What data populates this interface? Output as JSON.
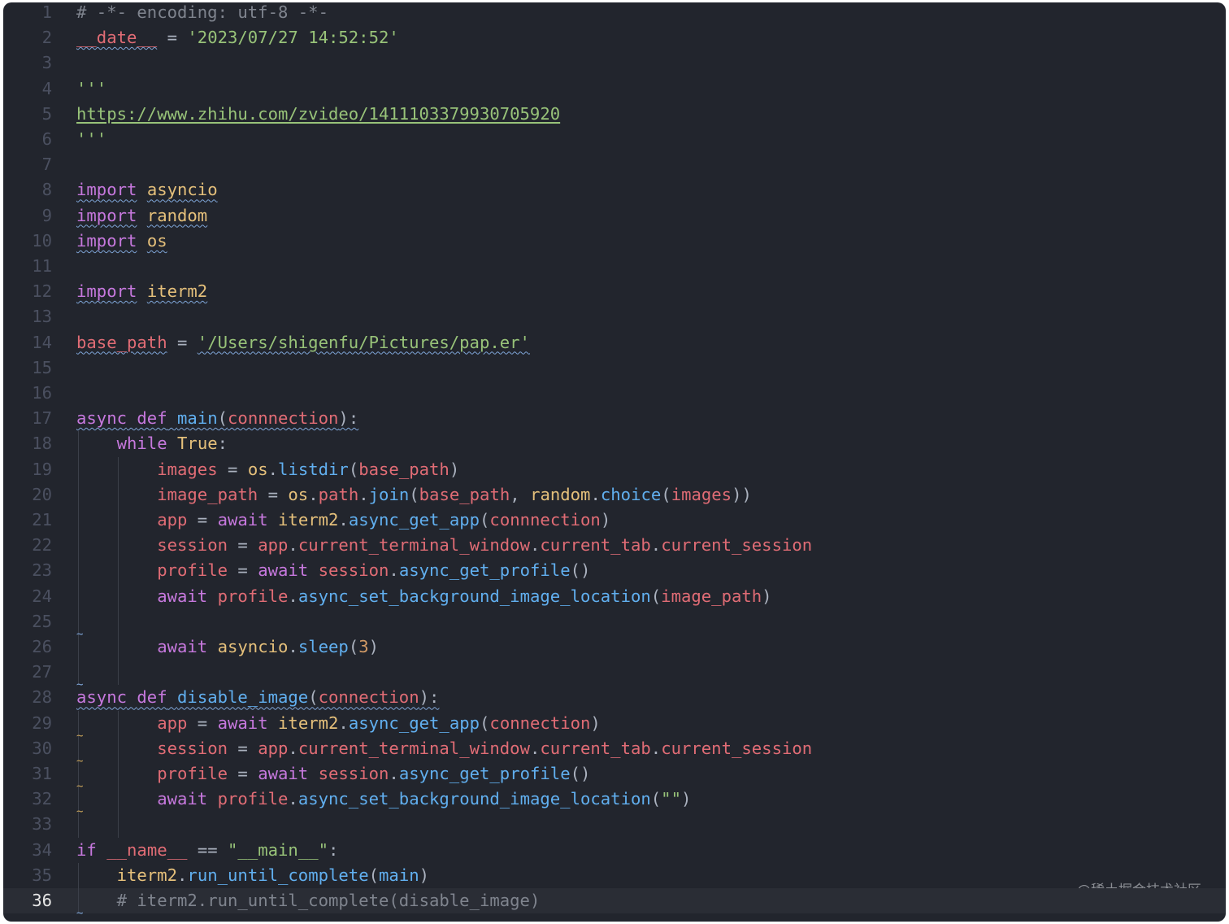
{
  "colors": {
    "background": "#22252d",
    "comment": "#7f848e",
    "keyword": "#c678dd",
    "variable": "#e06c75",
    "string": "#98c379",
    "function": "#61afef",
    "module": "#e5c07b",
    "plain": "#abb2bf",
    "number": "#d19a66",
    "url": "#98c379"
  },
  "lines": [
    {
      "n": "1",
      "tokens": [
        [
          "comment",
          "# -*- encoding: utf-8 -*-"
        ]
      ]
    },
    {
      "n": "2",
      "tokens": [
        [
          "variable",
          "__date__"
        ],
        [
          "plain",
          " = "
        ],
        [
          "string",
          "'2023/07/27 14:52:52'"
        ]
      ]
    },
    {
      "n": "3",
      "tokens": []
    },
    {
      "n": "4",
      "tokens": [
        [
          "string",
          "'''"
        ]
      ]
    },
    {
      "n": "5",
      "tokens": [
        [
          "url",
          "https://www.zhihu.com/zvideo/1411103379930705920"
        ]
      ]
    },
    {
      "n": "6",
      "tokens": [
        [
          "string",
          "'''"
        ]
      ]
    },
    {
      "n": "7",
      "tokens": []
    },
    {
      "n": "8",
      "tokens": [
        [
          "keyword",
          "import"
        ],
        [
          "plain",
          " "
        ],
        [
          "module",
          "asyncio"
        ]
      ]
    },
    {
      "n": "9",
      "tokens": [
        [
          "keyword",
          "import"
        ],
        [
          "plain",
          " "
        ],
        [
          "module",
          "random"
        ]
      ]
    },
    {
      "n": "10",
      "tokens": [
        [
          "keyword",
          "import"
        ],
        [
          "plain",
          " "
        ],
        [
          "module",
          "os"
        ]
      ]
    },
    {
      "n": "11",
      "tokens": []
    },
    {
      "n": "12",
      "tokens": [
        [
          "keyword",
          "import"
        ],
        [
          "plain",
          " "
        ],
        [
          "module",
          "iterm2"
        ]
      ]
    },
    {
      "n": "13",
      "tokens": []
    },
    {
      "n": "14",
      "tokens": [
        [
          "variable",
          "base_path"
        ],
        [
          "plain",
          " = "
        ],
        [
          "string",
          "'/Users/shigenfu/Pictures/pap.er'"
        ]
      ]
    },
    {
      "n": "15",
      "tokens": []
    },
    {
      "n": "16",
      "tokens": []
    },
    {
      "n": "17",
      "tokens": [
        [
          "keyword",
          "async"
        ],
        [
          "plain",
          " "
        ],
        [
          "keyword",
          "def"
        ],
        [
          "plain",
          " "
        ],
        [
          "function",
          "main"
        ],
        [
          "plain",
          "("
        ],
        [
          "variable",
          "connnection"
        ],
        [
          "plain",
          "):"
        ]
      ]
    },
    {
      "n": "18",
      "tokens": [
        [
          "plain",
          "    "
        ],
        [
          "keyword",
          "while"
        ],
        [
          "plain",
          " "
        ],
        [
          "module",
          "True"
        ],
        [
          "plain",
          ":"
        ]
      ]
    },
    {
      "n": "19",
      "tokens": [
        [
          "plain",
          "        "
        ],
        [
          "variable",
          "images"
        ],
        [
          "plain",
          " = "
        ],
        [
          "module",
          "os"
        ],
        [
          "plain",
          "."
        ],
        [
          "function",
          "listdir"
        ],
        [
          "plain",
          "("
        ],
        [
          "variable",
          "base_path"
        ],
        [
          "plain",
          ")"
        ]
      ]
    },
    {
      "n": "20",
      "tokens": [
        [
          "plain",
          "        "
        ],
        [
          "variable",
          "image_path"
        ],
        [
          "plain",
          " = "
        ],
        [
          "module",
          "os"
        ],
        [
          "plain",
          "."
        ],
        [
          "variable",
          "path"
        ],
        [
          "plain",
          "."
        ],
        [
          "function",
          "join"
        ],
        [
          "plain",
          "("
        ],
        [
          "variable",
          "base_path"
        ],
        [
          "plain",
          ", "
        ],
        [
          "module",
          "random"
        ],
        [
          "plain",
          "."
        ],
        [
          "function",
          "choice"
        ],
        [
          "plain",
          "("
        ],
        [
          "variable",
          "images"
        ],
        [
          "plain",
          "))"
        ]
      ]
    },
    {
      "n": "21",
      "tokens": [
        [
          "plain",
          "        "
        ],
        [
          "variable",
          "app"
        ],
        [
          "plain",
          " = "
        ],
        [
          "keyword",
          "await"
        ],
        [
          "plain",
          " "
        ],
        [
          "module",
          "iterm2"
        ],
        [
          "plain",
          "."
        ],
        [
          "function",
          "async_get_app"
        ],
        [
          "plain",
          "("
        ],
        [
          "variable",
          "connnection"
        ],
        [
          "plain",
          ")"
        ]
      ]
    },
    {
      "n": "22",
      "tokens": [
        [
          "plain",
          "        "
        ],
        [
          "variable",
          "session"
        ],
        [
          "plain",
          " = "
        ],
        [
          "variable",
          "app"
        ],
        [
          "plain",
          "."
        ],
        [
          "variable",
          "current_terminal_window"
        ],
        [
          "plain",
          "."
        ],
        [
          "variable",
          "current_tab"
        ],
        [
          "plain",
          "."
        ],
        [
          "variable",
          "current_session"
        ]
      ]
    },
    {
      "n": "23",
      "tokens": [
        [
          "plain",
          "        "
        ],
        [
          "variable",
          "profile"
        ],
        [
          "plain",
          " = "
        ],
        [
          "keyword",
          "await"
        ],
        [
          "plain",
          " "
        ],
        [
          "variable",
          "session"
        ],
        [
          "plain",
          "."
        ],
        [
          "function",
          "async_get_profile"
        ],
        [
          "plain",
          "()"
        ]
      ]
    },
    {
      "n": "24",
      "tokens": [
        [
          "plain",
          "        "
        ],
        [
          "keyword",
          "await"
        ],
        [
          "plain",
          " "
        ],
        [
          "variable",
          "profile"
        ],
        [
          "plain",
          "."
        ],
        [
          "function",
          "async_set_background_image_location"
        ],
        [
          "plain",
          "("
        ],
        [
          "variable",
          "image_path"
        ],
        [
          "plain",
          ")"
        ]
      ]
    },
    {
      "n": "25",
      "tokens": []
    },
    {
      "n": "26",
      "tokens": [
        [
          "plain",
          "        "
        ],
        [
          "keyword",
          "await"
        ],
        [
          "plain",
          " "
        ],
        [
          "module",
          "asyncio"
        ],
        [
          "plain",
          "."
        ],
        [
          "function",
          "sleep"
        ],
        [
          "plain",
          "("
        ],
        [
          "number",
          "3"
        ],
        [
          "plain",
          ")"
        ]
      ]
    },
    {
      "n": "27",
      "tokens": []
    },
    {
      "n": "28",
      "tokens": [
        [
          "keyword",
          "async"
        ],
        [
          "plain",
          " "
        ],
        [
          "keyword",
          "def"
        ],
        [
          "plain",
          " "
        ],
        [
          "function",
          "disable_image"
        ],
        [
          "plain",
          "("
        ],
        [
          "variable",
          "connection"
        ],
        [
          "plain",
          "):"
        ]
      ]
    },
    {
      "n": "29",
      "tokens": [
        [
          "plain",
          "        "
        ],
        [
          "variable",
          "app"
        ],
        [
          "plain",
          " = "
        ],
        [
          "keyword",
          "await"
        ],
        [
          "plain",
          " "
        ],
        [
          "module",
          "iterm2"
        ],
        [
          "plain",
          "."
        ],
        [
          "function",
          "async_get_app"
        ],
        [
          "plain",
          "("
        ],
        [
          "variable",
          "connection"
        ],
        [
          "plain",
          ")"
        ]
      ]
    },
    {
      "n": "30",
      "tokens": [
        [
          "plain",
          "        "
        ],
        [
          "variable",
          "session"
        ],
        [
          "plain",
          " = "
        ],
        [
          "variable",
          "app"
        ],
        [
          "plain",
          "."
        ],
        [
          "variable",
          "current_terminal_window"
        ],
        [
          "plain",
          "."
        ],
        [
          "variable",
          "current_tab"
        ],
        [
          "plain",
          "."
        ],
        [
          "variable",
          "current_session"
        ]
      ]
    },
    {
      "n": "31",
      "tokens": [
        [
          "plain",
          "        "
        ],
        [
          "variable",
          "profile"
        ],
        [
          "plain",
          " = "
        ],
        [
          "keyword",
          "await"
        ],
        [
          "plain",
          " "
        ],
        [
          "variable",
          "session"
        ],
        [
          "plain",
          "."
        ],
        [
          "function",
          "async_get_profile"
        ],
        [
          "plain",
          "()"
        ]
      ]
    },
    {
      "n": "32",
      "tokens": [
        [
          "plain",
          "        "
        ],
        [
          "keyword",
          "await"
        ],
        [
          "plain",
          " "
        ],
        [
          "variable",
          "profile"
        ],
        [
          "plain",
          "."
        ],
        [
          "function",
          "async_set_background_image_location"
        ],
        [
          "plain",
          "("
        ],
        [
          "string",
          "\"\""
        ],
        [
          "plain",
          ")"
        ]
      ]
    },
    {
      "n": "33",
      "tokens": []
    },
    {
      "n": "34",
      "tokens": [
        [
          "keyword",
          "if"
        ],
        [
          "plain",
          " "
        ],
        [
          "variable",
          "__name__"
        ],
        [
          "plain",
          " == "
        ],
        [
          "string",
          "\"__main__\""
        ],
        [
          "plain",
          ":"
        ]
      ]
    },
    {
      "n": "35",
      "tokens": [
        [
          "plain",
          "    "
        ],
        [
          "module",
          "iterm2"
        ],
        [
          "plain",
          "."
        ],
        [
          "function",
          "run_until_complete"
        ],
        [
          "plain",
          "("
        ],
        [
          "function",
          "main"
        ],
        [
          "plain",
          ")"
        ]
      ]
    },
    {
      "n": "36",
      "tokens": [
        [
          "plain",
          "    "
        ],
        [
          "comment",
          "# iterm2.run_until_complete(disable_image)"
        ]
      ],
      "current": true
    }
  ],
  "watermark": "@稀土掘金技术社区"
}
